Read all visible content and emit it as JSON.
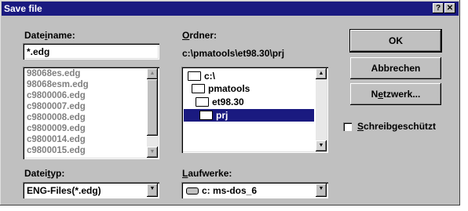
{
  "window": {
    "title": "Save file",
    "help_label": "?",
    "close_label": "✕"
  },
  "filename": {
    "label_pre": "Date",
    "label_u": "i",
    "label_post": "name:",
    "value": "*.edg"
  },
  "files": [
    "98068es.edg",
    "98068esm.edg",
    "c9800006.edg",
    "c9800007.edg",
    "c9800008.edg",
    "c9800009.edg",
    "c9800014.edg",
    "c9800015.edg"
  ],
  "folder": {
    "label_u": "O",
    "label_post": "rdner:",
    "path": "c:\\pmatools\\et98.30\\prj",
    "tree": [
      {
        "label": "c:\\",
        "selected": false
      },
      {
        "label": "pmatools",
        "selected": false
      },
      {
        "label": "et98.30",
        "selected": false
      },
      {
        "label": "prj",
        "selected": true
      }
    ]
  },
  "filetype": {
    "label_pre": "Datei",
    "label_u": "t",
    "label_post": "yp:",
    "value": "ENG-Files(*.edg)"
  },
  "drives": {
    "label_u": "L",
    "label_post": "aufwerke:",
    "value": "c: ms-dos_6"
  },
  "buttons": {
    "ok": "OK",
    "cancel": "Abbrechen",
    "network_pre": "N",
    "network_u": "e",
    "network_post": "tzwerk..."
  },
  "readonly": {
    "label_u": "S",
    "label_post": "chreibgeschützt",
    "checked": false
  }
}
